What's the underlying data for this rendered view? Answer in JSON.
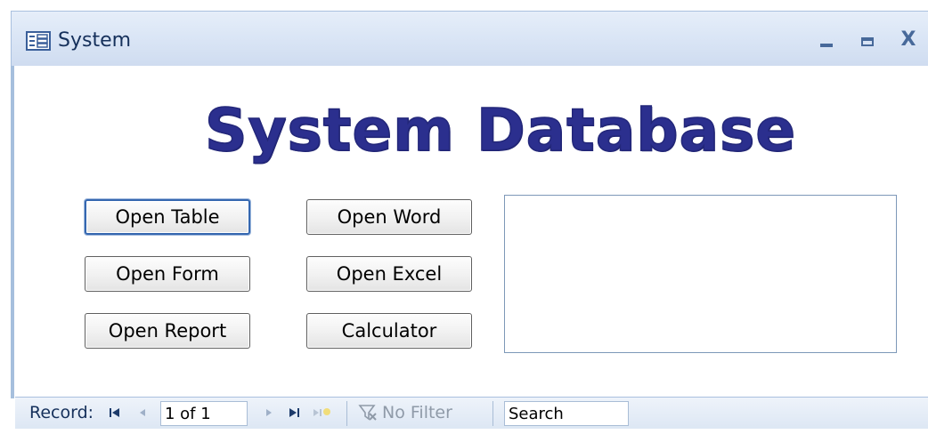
{
  "window": {
    "title": "System",
    "icon": "form-icon",
    "controls": {
      "minimize": "minimize-icon",
      "maximize": "maximize-icon",
      "close": "X"
    }
  },
  "form": {
    "heading": "System Database",
    "buttons": {
      "open_table": "Open Table",
      "open_form": "Open Form",
      "open_report": "Open Report",
      "open_word": "Open Word",
      "open_excel": "Open Excel",
      "calculator": "Calculator"
    },
    "colors": {
      "heading": "#2b2f8e",
      "focus_border": "#3567b0"
    }
  },
  "navigation": {
    "record_label": "Record:",
    "record_value": "1 of 1",
    "filter_label": "No Filter",
    "search_value": "Search",
    "icons": [
      "first-record-icon",
      "previous-record-icon",
      "next-record-icon",
      "last-record-icon",
      "new-record-icon",
      "filter-icon"
    ]
  }
}
